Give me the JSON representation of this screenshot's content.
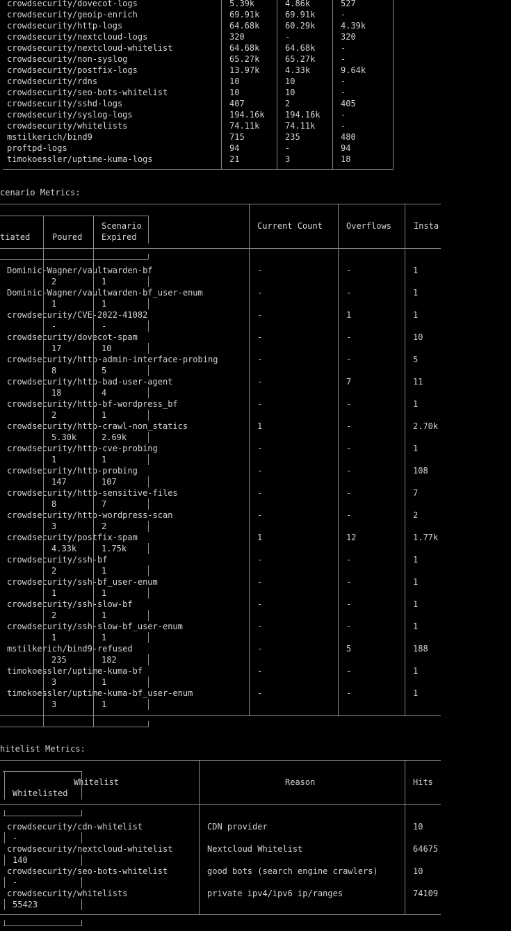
{
  "parser_rows": [
    {
      "name": "crowdsecurity/dovecot-logs",
      "hits": "5.39k",
      "parsed": "4.86k",
      "unparsed": "527"
    },
    {
      "name": "crowdsecurity/geoip-enrich",
      "hits": "69.91k",
      "parsed": "69.91k",
      "unparsed": "-"
    },
    {
      "name": "crowdsecurity/http-logs",
      "hits": "64.68k",
      "parsed": "60.29k",
      "unparsed": "4.39k"
    },
    {
      "name": "crowdsecurity/nextcloud-logs",
      "hits": "320",
      "parsed": "-",
      "unparsed": "320"
    },
    {
      "name": "crowdsecurity/nextcloud-whitelist",
      "hits": "64.68k",
      "parsed": "64.68k",
      "unparsed": "-"
    },
    {
      "name": "crowdsecurity/non-syslog",
      "hits": "65.27k",
      "parsed": "65.27k",
      "unparsed": "-"
    },
    {
      "name": "crowdsecurity/postfix-logs",
      "hits": "13.97k",
      "parsed": "4.33k",
      "unparsed": "9.64k"
    },
    {
      "name": "crowdsecurity/rdns",
      "hits": "10",
      "parsed": "10",
      "unparsed": "-"
    },
    {
      "name": "crowdsecurity/seo-bots-whitelist",
      "hits": "10",
      "parsed": "10",
      "unparsed": "-"
    },
    {
      "name": "crowdsecurity/sshd-logs",
      "hits": "407",
      "parsed": "2",
      "unparsed": "405"
    },
    {
      "name": "crowdsecurity/syslog-logs",
      "hits": "194.16k",
      "parsed": "194.16k",
      "unparsed": "-"
    },
    {
      "name": "crowdsecurity/whitelists",
      "hits": "74.11k",
      "parsed": "74.11k",
      "unparsed": "-"
    },
    {
      "name": "mstilkerich/bind9",
      "hits": "715",
      "parsed": "235",
      "unparsed": "480"
    },
    {
      "name": "proftpd-logs",
      "hits": "94",
      "parsed": "-",
      "unparsed": "94"
    },
    {
      "name": "timokoessler/uptime-kuma-logs",
      "hits": "21",
      "parsed": "3",
      "unparsed": "18"
    }
  ],
  "scenario": {
    "title": "cenario Metrics:",
    "headers": {
      "scenario": "Scenario",
      "current_count": "Current Count",
      "overflows": "Overflows",
      "instantiated_right": "Insta",
      "instantiated_left": "tiated",
      "poured": "Poured",
      "expired": "Expired"
    },
    "rows": [
      {
        "name": "Dominic-Wagner/vaultwarden-bf",
        "current": "-",
        "overflows": "-",
        "instantiated": "1",
        "poured": "2",
        "expired": "1"
      },
      {
        "name": "Dominic-Wagner/vaultwarden-bf_user-enum",
        "current": "-",
        "overflows": "-",
        "instantiated": "1",
        "poured": "1",
        "expired": "1"
      },
      {
        "name": "crowdsecurity/CVE-2022-41082",
        "current": "-",
        "overflows": "1",
        "instantiated": "1",
        "poured": "-",
        "expired": "-"
      },
      {
        "name": "crowdsecurity/dovecot-spam",
        "current": "-",
        "overflows": "-",
        "instantiated": "10",
        "poured": "17",
        "expired": "10"
      },
      {
        "name": "crowdsecurity/http-admin-interface-probing",
        "current": "-",
        "overflows": "-",
        "instantiated": "5",
        "poured": "8",
        "expired": "5"
      },
      {
        "name": "crowdsecurity/http-bad-user-agent",
        "current": "-",
        "overflows": "7",
        "instantiated": "11",
        "poured": "18",
        "expired": "4"
      },
      {
        "name": "crowdsecurity/http-bf-wordpress_bf",
        "current": "-",
        "overflows": "-",
        "instantiated": "1",
        "poured": "2",
        "expired": "1"
      },
      {
        "name": "crowdsecurity/http-crawl-non_statics",
        "current": "1",
        "overflows": "-",
        "instantiated": "2.70k",
        "poured": "5.30k",
        "expired": "2.69k"
      },
      {
        "name": "crowdsecurity/http-cve-probing",
        "current": "-",
        "overflows": "-",
        "instantiated": "1",
        "poured": "1",
        "expired": "1"
      },
      {
        "name": "crowdsecurity/http-probing",
        "current": "-",
        "overflows": "-",
        "instantiated": "108",
        "poured": "147",
        "expired": "107"
      },
      {
        "name": "crowdsecurity/http-sensitive-files",
        "current": "-",
        "overflows": "-",
        "instantiated": "7",
        "poured": "8",
        "expired": "7"
      },
      {
        "name": "crowdsecurity/http-wordpress-scan",
        "current": "-",
        "overflows": "-",
        "instantiated": "2",
        "poured": "3",
        "expired": "2"
      },
      {
        "name": "crowdsecurity/postfix-spam",
        "current": "1",
        "overflows": "12",
        "instantiated": "1.77k",
        "poured": "4.33k",
        "expired": "1.75k"
      },
      {
        "name": "crowdsecurity/ssh-bf",
        "current": "-",
        "overflows": "-",
        "instantiated": "1",
        "poured": "2",
        "expired": "1"
      },
      {
        "name": "crowdsecurity/ssh-bf_user-enum",
        "current": "-",
        "overflows": "-",
        "instantiated": "1",
        "poured": "1",
        "expired": "1"
      },
      {
        "name": "crowdsecurity/ssh-slow-bf",
        "current": "-",
        "overflows": "-",
        "instantiated": "1",
        "poured": "2",
        "expired": "1"
      },
      {
        "name": "crowdsecurity/ssh-slow-bf_user-enum",
        "current": "-",
        "overflows": "-",
        "instantiated": "1",
        "poured": "1",
        "expired": "1"
      },
      {
        "name": "mstilkerich/bind9-refused",
        "current": "-",
        "overflows": "5",
        "instantiated": "188",
        "poured": "235",
        "expired": "182"
      },
      {
        "name": "timokoessler/uptime-kuma-bf",
        "current": "-",
        "overflows": "-",
        "instantiated": "1",
        "poured": "3",
        "expired": "1"
      },
      {
        "name": "timokoessler/uptime-kuma-bf_user-enum",
        "current": "-",
        "overflows": "-",
        "instantiated": "1",
        "poured": "3",
        "expired": "1"
      }
    ]
  },
  "whitelist": {
    "title": "hitelist Metrics:",
    "headers": {
      "whitelist": "Whitelist",
      "reason": "Reason",
      "hits": "Hits",
      "whitelisted": "Whitelisted"
    },
    "rows": [
      {
        "name": "crowdsecurity/cdn-whitelist",
        "reason": "CDN provider",
        "hits": "10",
        "whitelisted": "-"
      },
      {
        "name": "crowdsecurity/nextcloud-whitelist",
        "reason": "Nextcloud Whitelist",
        "hits": "64675",
        "whitelisted": "140"
      },
      {
        "name": "crowdsecurity/seo-bots-whitelist",
        "reason": "good bots (search engine crawlers)",
        "hits": "10",
        "whitelisted": "-"
      },
      {
        "name": "crowdsecurity/whitelists",
        "reason": "private ipv4/ipv6 ip/ranges",
        "hits": "74109",
        "whitelisted": "55423"
      }
    ]
  }
}
